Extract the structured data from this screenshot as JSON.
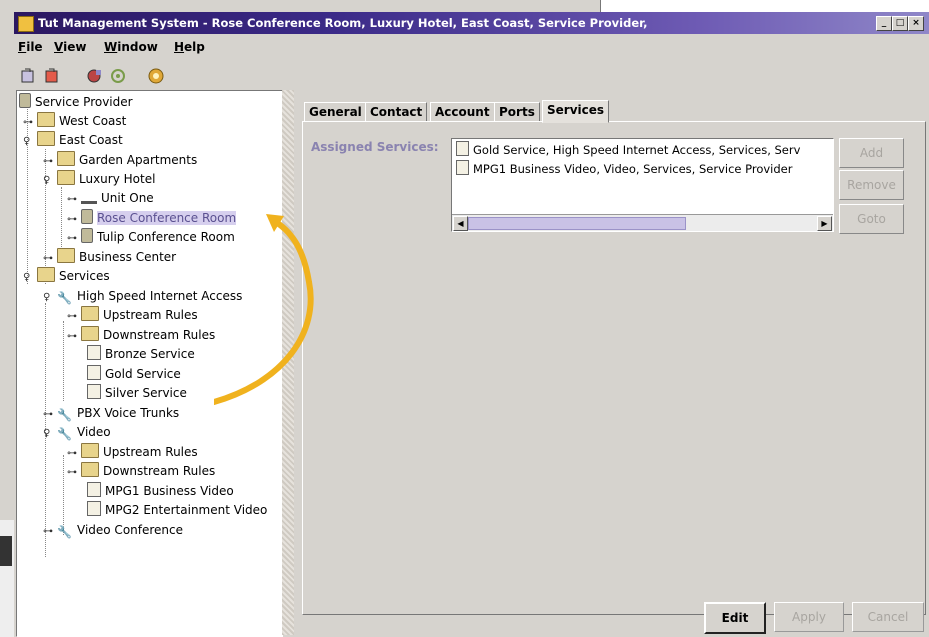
{
  "window": {
    "title": "Tut Management System - Rose Conference Room, Luxury Hotel, East Coast, Service Provider,"
  },
  "menu": [
    {
      "mnemonic": "F",
      "rest": "ile"
    },
    {
      "mnemonic": "V",
      "rest": "iew"
    },
    {
      "mnemonic": "W",
      "rest": "indow"
    },
    {
      "mnemonic": "H",
      "rest": "elp"
    }
  ],
  "toolbar": {
    "icons": [
      "back-icon",
      "forward-icon",
      "refresh-icon",
      "settings-icon",
      "gear-icon"
    ]
  },
  "tree": [
    {
      "label": "Service Provider",
      "icon": "server"
    },
    {
      "label": "West Coast",
      "icon": "folder"
    },
    {
      "label": "East Coast",
      "icon": "folder"
    },
    {
      "label": "Garden Apartments",
      "icon": "folder"
    },
    {
      "label": "Luxury Hotel",
      "icon": "folder"
    },
    {
      "label": "Unit One",
      "icon": "cable"
    },
    {
      "label": "Rose Conference Room",
      "icon": "server",
      "selected": true
    },
    {
      "label": "Tulip Conference Room",
      "icon": "server"
    },
    {
      "label": "Business Center",
      "icon": "folder"
    },
    {
      "label": "Services",
      "icon": "folder"
    },
    {
      "label": "High Speed Internet Access",
      "icon": "wrench"
    },
    {
      "label": "Upstream Rules",
      "icon": "folder"
    },
    {
      "label": "Downstream Rules",
      "icon": "folder"
    },
    {
      "label": "Bronze Service",
      "icon": "doc"
    },
    {
      "label": "Gold Service",
      "icon": "doc"
    },
    {
      "label": "Silver Service",
      "icon": "doc"
    },
    {
      "label": "PBX Voice Trunks",
      "icon": "wrench"
    },
    {
      "label": "Video",
      "icon": "wrench"
    },
    {
      "label": "Upstream Rules",
      "icon": "folder"
    },
    {
      "label": "Downstream Rules",
      "icon": "folder"
    },
    {
      "label": "MPG1 Business Video",
      "icon": "doc"
    },
    {
      "label": "MPG2 Entertainment Video",
      "icon": "doc"
    },
    {
      "label": "Video Conference",
      "icon": "wrench"
    }
  ],
  "tabs": [
    "General",
    "Contact",
    "Account",
    "Ports",
    "Services"
  ],
  "active_tab": "Services",
  "services": {
    "label": "Assigned Services:",
    "items": [
      "Gold Service, High Speed Internet Access, Services, Serv",
      "MPG1 Business Video, Video, Services, Service Provider"
    ],
    "scroll_fraction": 0.62,
    "buttons": {
      "add": "Add",
      "remove": "Remove",
      "goto": "Goto"
    }
  },
  "footer": {
    "edit": "Edit",
    "apply": "Apply",
    "cancel": "Cancel"
  },
  "colors": {
    "selection": "#d6cfee",
    "annotation_arrow": "#f0b21e",
    "title_bar": "#2b1760"
  }
}
